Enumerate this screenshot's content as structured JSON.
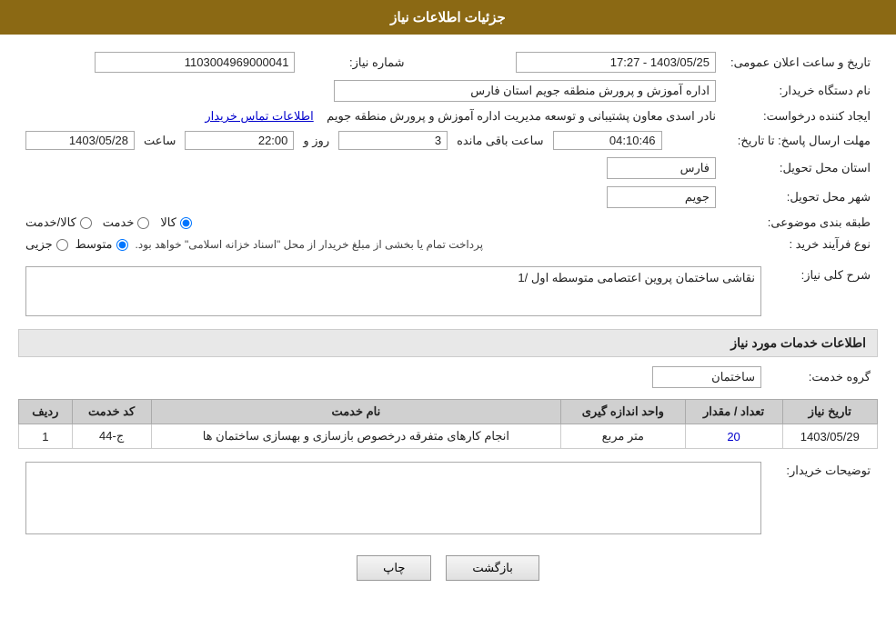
{
  "header": {
    "title": "جزئیات اطلاعات نیاز"
  },
  "fields": {
    "need_number_label": "شماره نیاز:",
    "need_number_value": "1103004969000041",
    "buyer_org_label": "نام دستگاه خریدار:",
    "buyer_org_value": "اداره آموزش و پرورش منطقه جویم استان فارس",
    "creator_label": "ایجاد کننده درخواست:",
    "creator_value": "نادر اسدی معاون پشتیبانی و توسعه مدیریت اداره آموزش و پرورش منطقه جویم",
    "creator_link": "اطلاعات تماس خریدار",
    "send_date_label": "مهلت ارسال پاسخ: تا تاریخ:",
    "announce_date_label": "تاریخ و ساعت اعلان عمومی:",
    "announce_date_value": "1403/05/25 - 17:27",
    "deadline_date": "1403/05/28",
    "deadline_time": "22:00",
    "deadline_days": "3",
    "deadline_remain": "04:10:46",
    "province_label": "استان محل تحویل:",
    "province_value": "فارس",
    "city_label": "شهر محل تحویل:",
    "city_value": "جویم",
    "category_label": "طبقه بندی موضوعی:",
    "category_radio1": "کالا",
    "category_radio2": "خدمت",
    "category_radio3": "کالا/خدمت",
    "process_label": "نوع فرآیند خرید :",
    "process_radio1": "جزیی",
    "process_radio2": "متوسط",
    "process_note": "پرداخت تمام یا بخشی از مبلغ خریدار از محل \"اسناد خزانه اسلامی\" خواهد بود.",
    "description_label": "شرح کلی نیاز:",
    "description_value": "نقاشی  ساختمان  پروین اعتصامی متوسطه اول /1",
    "services_section_title": "اطلاعات خدمات مورد نیاز",
    "service_group_label": "گروه خدمت:",
    "service_group_value": "ساختمان",
    "table": {
      "col_row": "ردیف",
      "col_code": "کد خدمت",
      "col_name": "نام خدمت",
      "col_unit": "واحد اندازه گیری",
      "col_qty": "تعداد / مقدار",
      "col_date": "تاریخ نیاز",
      "rows": [
        {
          "row": "1",
          "code": "ج-44",
          "name": "انجام کارهای متفرقه درخصوص بازسازی و بهسازی ساختمان ها",
          "unit": "متر مربع",
          "qty": "20",
          "date": "1403/05/29"
        }
      ]
    },
    "buyer_desc_label": "توضیحات خریدار:",
    "buyer_desc_value": "",
    "btn_back": "بازگشت",
    "btn_print": "چاپ",
    "days_label": "روز و",
    "remain_label": "ساعت باقی مانده"
  }
}
